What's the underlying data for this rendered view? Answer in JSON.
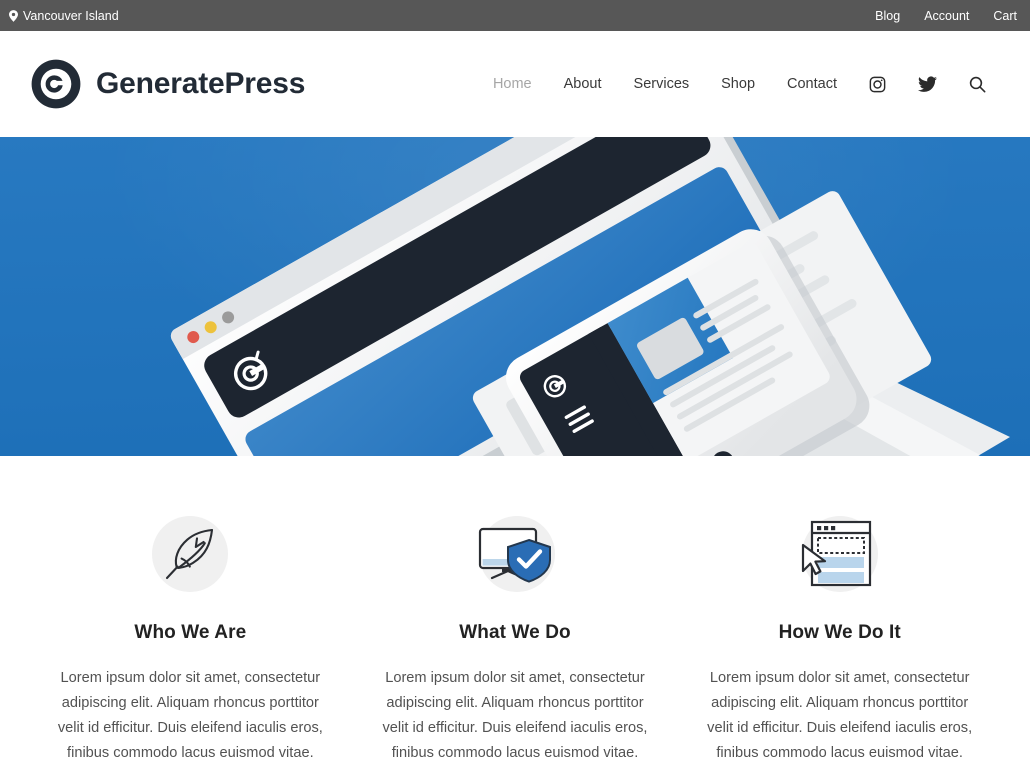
{
  "topbar": {
    "location_icon": "map-pin-icon",
    "location": "Vancouver Island",
    "links": [
      {
        "label": "Blog"
      },
      {
        "label": "Account"
      },
      {
        "label": "Cart"
      }
    ]
  },
  "header": {
    "logo_icon": "generatepress-logo-icon",
    "brand": "GeneratePress",
    "nav": [
      {
        "label": "Home",
        "active": true
      },
      {
        "label": "About",
        "active": false
      },
      {
        "label": "Services",
        "active": false
      },
      {
        "label": "Shop",
        "active": false
      },
      {
        "label": "Contact",
        "active": false
      }
    ],
    "icons": [
      {
        "name": "instagram-icon"
      },
      {
        "name": "twitter-icon"
      },
      {
        "name": "search-icon"
      }
    ]
  },
  "hero": {
    "background_color": "#1e73be",
    "illustration": "isometric-browser-and-phone-mockup",
    "elements": {
      "browser_window": "laptop-browser-window",
      "phone": "smartphone-with-article",
      "traffic_lights": [
        "#e05a4d",
        "#edc23c",
        "#9b9b9b"
      ],
      "dark_bar_color": "#1d2530",
      "screen_blue": "#2b7ec4"
    }
  },
  "features": [
    {
      "icon": "feather-quill-icon",
      "title": "Who We Are",
      "text": "Lorem ipsum dolor sit amet, consectetur adipiscing elit. Aliquam rhoncus porttitor velit id efficitur. Duis eleifend iaculis eros, finibus commodo lacus euismod vitae."
    },
    {
      "icon": "monitor-shield-icon",
      "title": "What We Do",
      "text": "Lorem ipsum dolor sit amet, consectetur adipiscing elit. Aliquam rhoncus porttitor velit id efficitur. Duis eleifend iaculis eros, finibus commodo lacus euismod vitae."
    },
    {
      "icon": "page-builder-cursor-icon",
      "title": "How We Do It",
      "text": "Lorem ipsum dolor sit amet, consectetur adipiscing elit. Aliquam rhoncus porttitor velit id efficitur. Duis eleifend iaculis eros, finibus commodo lacus euismod vitae."
    }
  ],
  "colors": {
    "topbar_bg": "#575757",
    "accent_blue": "#1e73be",
    "shield_blue": "#2a6db5",
    "text_dark": "#222222",
    "text_body": "#525252",
    "nav_active": "#a6a6a6"
  }
}
